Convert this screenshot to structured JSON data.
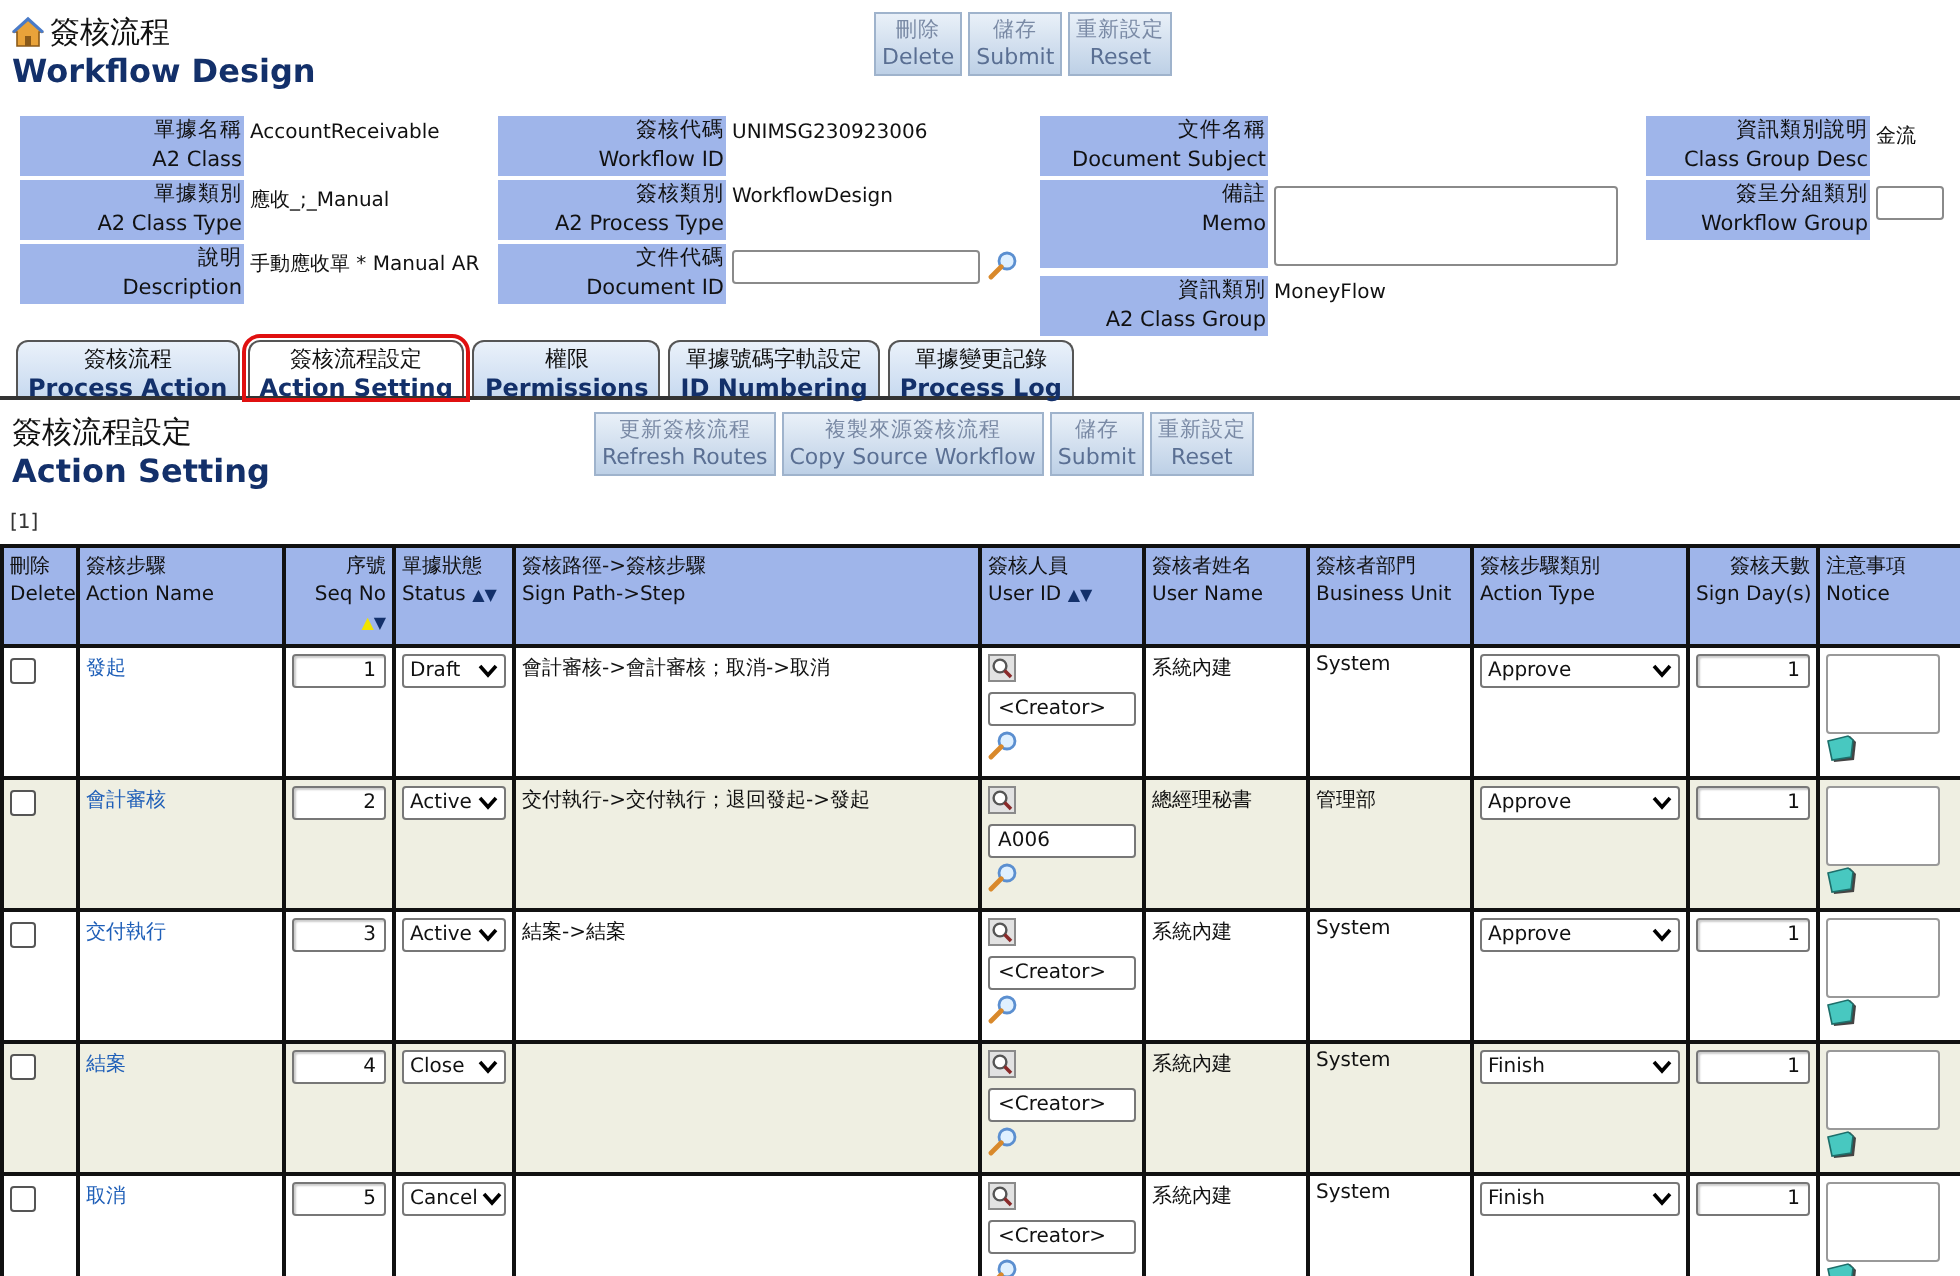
{
  "header": {
    "title_zh": "簽核流程",
    "title_en": "Workflow Design"
  },
  "top_buttons": [
    {
      "zh": "刪除",
      "en": "Delete"
    },
    {
      "zh": "儲存",
      "en": "Submit"
    },
    {
      "zh": "重新設定",
      "en": "Reset"
    }
  ],
  "form_groups": [
    {
      "fields": [
        {
          "label_zh": "單據名稱",
          "label_en": "A2 Class",
          "kind": "text",
          "value": "AccountReceivable"
        },
        {
          "label_zh": "單據類別",
          "label_en": "A2 Class Type",
          "kind": "text",
          "value": "應收_;_Manual"
        },
        {
          "label_zh": "說明",
          "label_en": "Description",
          "kind": "text",
          "value": "手動應收單 * Manual AR"
        }
      ]
    },
    {
      "fields": [
        {
          "label_zh": "簽核代碼",
          "label_en": "Workflow ID",
          "kind": "text",
          "value": "UNIMSG230923006"
        },
        {
          "label_zh": "簽核類別",
          "label_en": "A2 Process Type",
          "kind": "text",
          "value": "WorkflowDesign"
        },
        {
          "label_zh": "文件代碼",
          "label_en": "Document ID",
          "kind": "input-search"
        }
      ]
    },
    {
      "fields": [
        {
          "label_zh": "文件名稱",
          "label_en": "Document Subject",
          "kind": "text"
        },
        {
          "label_zh": "備註",
          "label_en": "Memo",
          "kind": "textarea"
        },
        {
          "label_zh": "資訊類別",
          "label_en": "A2 Class Group",
          "kind": "text",
          "value": "MoneyFlow"
        }
      ]
    },
    {
      "fields": [
        {
          "label_zh": "資訊類別說明",
          "label_en": "Class Group Desc",
          "kind": "text",
          "value": "金流"
        },
        {
          "label_zh": "簽呈分組類別",
          "label_en": "Workflow Group",
          "kind": "input"
        }
      ]
    }
  ],
  "tabs": [
    {
      "zh": "簽核流程",
      "en": "Process Action",
      "selected": false
    },
    {
      "zh": "簽核流程設定",
      "en": "Action Setting",
      "selected": true
    },
    {
      "zh": "權限",
      "en": "Permissions",
      "selected": false
    },
    {
      "zh": "單據號碼字軌設定",
      "en": "ID Numbering",
      "selected": false
    },
    {
      "zh": "單據變更記錄",
      "en": "Process Log",
      "selected": false
    }
  ],
  "section": {
    "title_zh": "簽核流程設定",
    "title_en": "Action Setting"
  },
  "section_buttons": [
    {
      "zh": "更新簽核流程",
      "en": "Refresh Routes"
    },
    {
      "zh": "複製來源簽核流程",
      "en": "Copy Source Workflow"
    },
    {
      "zh": "儲存",
      "en": "Submit"
    },
    {
      "zh": "重新設定",
      "en": "Reset"
    }
  ],
  "pager": "[1]",
  "table": {
    "columns": [
      {
        "zh": "刪除",
        "en": "Delete"
      },
      {
        "zh": "簽核步驟",
        "en": "Action Name"
      },
      {
        "zh": "序號",
        "en": "Seq No",
        "sort_ascending": true,
        "sort_up": "▲",
        "sort_down": "▼"
      },
      {
        "zh": "單據狀態",
        "en": "Status",
        "sort_ascending": false,
        "sort_up": "▲",
        "sort_down": "▼"
      },
      {
        "zh": "簽核路徑->簽核步驟",
        "en": "Sign Path->Step"
      },
      {
        "zh": "簽核人員",
        "en": "User ID",
        "sort_ascending": false,
        "sort_up": "▲",
        "sort_down": "▼"
      },
      {
        "zh": "簽核者姓名",
        "en": "User Name"
      },
      {
        "zh": "簽核者部門",
        "en": "Business Unit"
      },
      {
        "zh": "簽核步驟類別",
        "en": "Action Type"
      },
      {
        "zh": "簽核天數",
        "en": "Sign Day(s)"
      },
      {
        "zh": "注意事項",
        "en": "Notice"
      }
    ],
    "rows": [
      {
        "checked": false,
        "action_name": "發起",
        "seq": "1",
        "status": "Draft",
        "sign_path": "會計審核->會計審核；取消->取消",
        "user_id": "<Creator>",
        "user_name": "系統內建",
        "business_unit": "System",
        "action_type": "Approve",
        "sign_days": "1"
      },
      {
        "checked": false,
        "action_name": "會計審核",
        "seq": "2",
        "status": "Active",
        "sign_path": "交付執行->交付執行；退回發起->發起",
        "user_id": "A006",
        "user_name": "總經理秘書",
        "business_unit": "管理部",
        "action_type": "Approve",
        "sign_days": "1"
      },
      {
        "checked": false,
        "action_name": "交付執行",
        "seq": "3",
        "status": "Active",
        "sign_path": "結案->結案",
        "user_id": "<Creator>",
        "user_name": "系統內建",
        "business_unit": "System",
        "action_type": "Approve",
        "sign_days": "1"
      },
      {
        "checked": false,
        "action_name": "結案",
        "seq": "4",
        "status": "Close",
        "user_id": "<Creator>",
        "user_name": "系統內建",
        "business_unit": "System",
        "action_type": "Finish",
        "sign_days": "1"
      },
      {
        "checked": false,
        "action_name": "取消",
        "seq": "5",
        "status": "Cancel",
        "user_id": "<Creator>",
        "user_name": "系統內建",
        "business_unit": "System",
        "action_type": "Finish",
        "sign_days": "1"
      }
    ]
  }
}
